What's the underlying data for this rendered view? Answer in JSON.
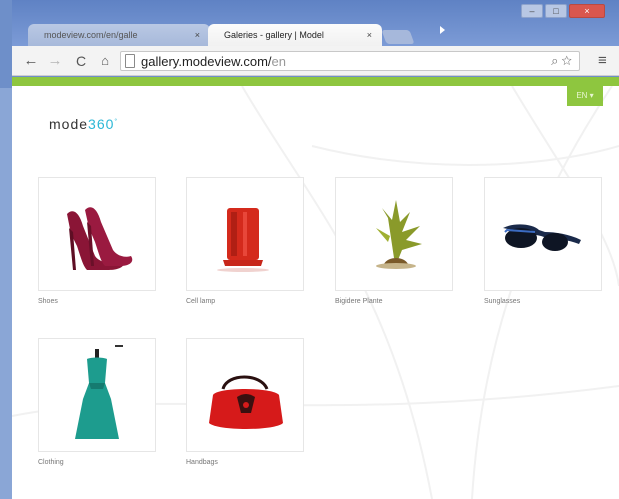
{
  "browser": {
    "tabs": [
      {
        "label": "modeview.com/en/galle",
        "close": "×"
      },
      {
        "label": "Galeries - gallery | Model",
        "close": "×"
      }
    ],
    "url_host": "gallery.modeview.com/",
    "url_path": "en",
    "window_buttons": {
      "minimize": "–",
      "maximize": "□",
      "close": "×"
    }
  },
  "site": {
    "logo_text": "mode",
    "logo_360": "360",
    "logo_sup": "°",
    "lang_label": "EN ▾"
  },
  "gallery": {
    "items": [
      {
        "caption": "Shoes",
        "icon": "shoes-image"
      },
      {
        "caption": "Cell lamp",
        "icon": "red-lamp-image"
      },
      {
        "caption": "Bigidere Plante",
        "icon": "plant-image"
      },
      {
        "caption": "Sunglasses",
        "icon": "sunglasses-image"
      },
      {
        "caption": "Clothing",
        "icon": "dress-image"
      },
      {
        "caption": "Handbags",
        "icon": "handbag-image"
      }
    ]
  },
  "colors": {
    "accent_green": "#8ec63f",
    "logo_blue": "#2bb7d6",
    "window_blue": "#6e8fc9"
  }
}
